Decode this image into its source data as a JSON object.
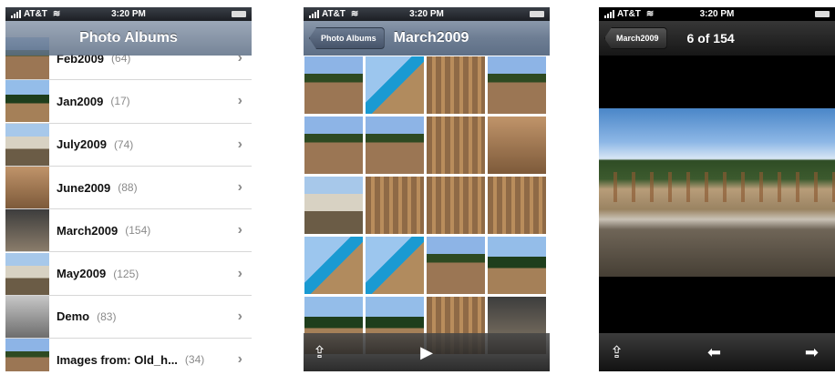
{
  "status": {
    "carrier": "AT&T",
    "time": "3:20 PM"
  },
  "albums_screen": {
    "title": "Photo Albums",
    "albums": [
      {
        "name": "Feb2009",
        "count": "(64)",
        "palette": "p-site"
      },
      {
        "name": "Jan2009",
        "count": "(17)",
        "palette": "p-trees"
      },
      {
        "name": "July2009",
        "count": "(74)",
        "palette": "p-house"
      },
      {
        "name": "June2009",
        "count": "(88)",
        "palette": "p-wood"
      },
      {
        "name": "March2009",
        "count": "(154)",
        "palette": "p-dark"
      },
      {
        "name": "May2009",
        "count": "(125)",
        "palette": "p-house"
      },
      {
        "name": "Demo",
        "count": "(83)",
        "palette": "p-grey"
      },
      {
        "name": "Images from: Old_h...",
        "count": "(34)",
        "palette": "p-site"
      }
    ]
  },
  "grid_screen": {
    "back_label": "Photo Albums",
    "title": "March2009",
    "thumbs": [
      "p-site",
      "p-crane",
      "p-frame",
      "p-site",
      "p-site",
      "p-site",
      "p-frame",
      "p-wood",
      "p-house",
      "p-frame",
      "p-frame",
      "p-frame",
      "p-crane",
      "p-crane",
      "p-site",
      "p-trees",
      "p-trees",
      "p-trees",
      "p-frame",
      "p-dark"
    ]
  },
  "photo_screen": {
    "back_label": "March2009",
    "counter": "6 of 154"
  },
  "icons": {
    "share": "share-icon",
    "play": "play-icon",
    "prev": "left-arrow-icon",
    "next": "right-arrow-icon"
  }
}
